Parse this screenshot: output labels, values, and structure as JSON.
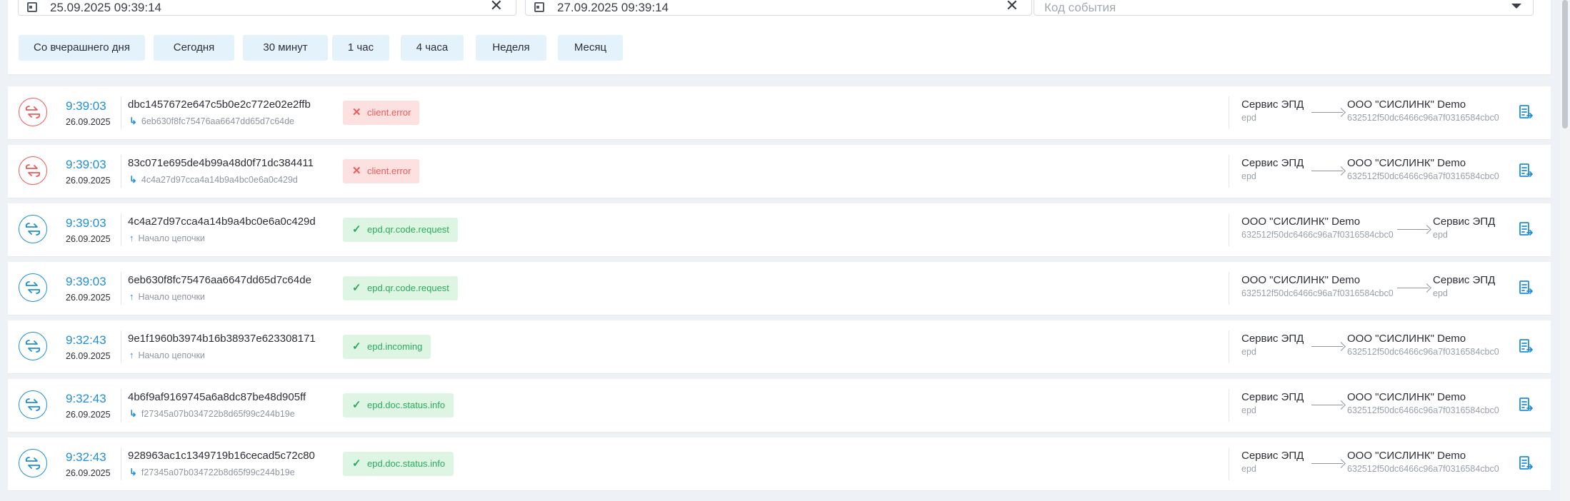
{
  "filters": {
    "date_from": "25.09.2025 09:39:14",
    "date_to": "27.09.2025 09:39:14",
    "event_code_placeholder": "Код события",
    "quick_ranges": [
      "Со вчерашнего дня",
      "Сегодня",
      "30 минут",
      "1 час",
      "4 часа",
      "Неделя",
      "Месяц"
    ]
  },
  "colors": {
    "accent": "#1f8fd6",
    "error": "#ee5a5a",
    "success": "#2aab5a",
    "quick_bg": "#e4f2fc"
  },
  "rows": [
    {
      "status": "error",
      "icon": "exchange-arrows-icon",
      "time": "9:39:03",
      "date": "26.09.2025",
      "hash": "dbc1457672e647c5b0e2c772e02e2ffb",
      "parent_icon": "reply-arrow-icon",
      "parent": "6eb630f8fc75476aa6647dd65d7c64de",
      "event": "client.error",
      "from_name": "Сервис ЭПД",
      "from_id": "epd",
      "to_name": "ООО \"СИСЛИНК\" Demo",
      "to_id": "632512f50dc6466c96a7f0316584cbc0"
    },
    {
      "status": "error",
      "icon": "exchange-arrows-icon",
      "time": "9:39:03",
      "date": "26.09.2025",
      "hash": "83c071e695de4b99a48d0f71dc384411",
      "parent_icon": "reply-arrow-icon",
      "parent": "4c4a27d97cca4a14b9a4bc0e6a0c429d",
      "event": "client.error",
      "from_name": "Сервис ЭПД",
      "from_id": "epd",
      "to_name": "ООО \"СИСЛИНК\" Demo",
      "to_id": "632512f50dc6466c96a7f0316584cbc0"
    },
    {
      "status": "ok",
      "icon": "exchange-arrows-icon",
      "time": "9:39:03",
      "date": "26.09.2025",
      "hash": "4c4a27d97cca4a14b9a4bc0e6a0c429d",
      "parent_icon": "up-arrow-icon",
      "parent": "Начало цепочки",
      "event": "epd.qr.code.request",
      "from_name": "ООО \"СИСЛИНК\" Demo",
      "from_id": "632512f50dc6466c96a7f0316584cbc0",
      "to_name": "Сервис ЭПД",
      "to_id": "epd"
    },
    {
      "status": "ok",
      "icon": "exchange-arrows-icon",
      "time": "9:39:03",
      "date": "26.09.2025",
      "hash": "6eb630f8fc75476aa6647dd65d7c64de",
      "parent_icon": "up-arrow-icon",
      "parent": "Начало цепочки",
      "event": "epd.qr.code.request",
      "from_name": "ООО \"СИСЛИНК\" Demo",
      "from_id": "632512f50dc6466c96a7f0316584cbc0",
      "to_name": "Сервис ЭПД",
      "to_id": "epd"
    },
    {
      "status": "ok",
      "icon": "exchange-arrows-icon",
      "time": "9:32:43",
      "date": "26.09.2025",
      "hash": "9e1f1960b3974b16b38937e623308171",
      "parent_icon": "up-arrow-icon",
      "parent": "Начало цепочки",
      "event": "epd.incoming",
      "from_name": "Сервис ЭПД",
      "from_id": "epd",
      "to_name": "ООО \"СИСЛИНК\" Demo",
      "to_id": "632512f50dc6466c96a7f0316584cbc0"
    },
    {
      "status": "ok",
      "icon": "exchange-arrows-icon",
      "time": "9:32:43",
      "date": "26.09.2025",
      "hash": "4b6f9af9169745a6a8dc87be48d905ff",
      "parent_icon": "reply-arrow-icon",
      "parent": "f27345a07b034722b8d65f99c244b19e",
      "event": "epd.doc.status.info",
      "from_name": "Сервис ЭПД",
      "from_id": "epd",
      "to_name": "ООО \"СИСЛИНК\" Demo",
      "to_id": "632512f50dc6466c96a7f0316584cbc0"
    },
    {
      "status": "ok",
      "icon": "exchange-arrows-icon",
      "time": "9:32:43",
      "date": "26.09.2025",
      "hash": "928963ac1c1349719b16cecad5c72c80",
      "parent_icon": "reply-arrow-icon",
      "parent": "f27345a07b034722b8d65f99c244b19e",
      "event": "epd.doc.status.info",
      "from_name": "Сервис ЭПД",
      "from_id": "epd",
      "to_name": "ООО \"СИСЛИНК\" Demo",
      "to_id": "632512f50dc6466c96a7f0316584cbc0"
    }
  ]
}
